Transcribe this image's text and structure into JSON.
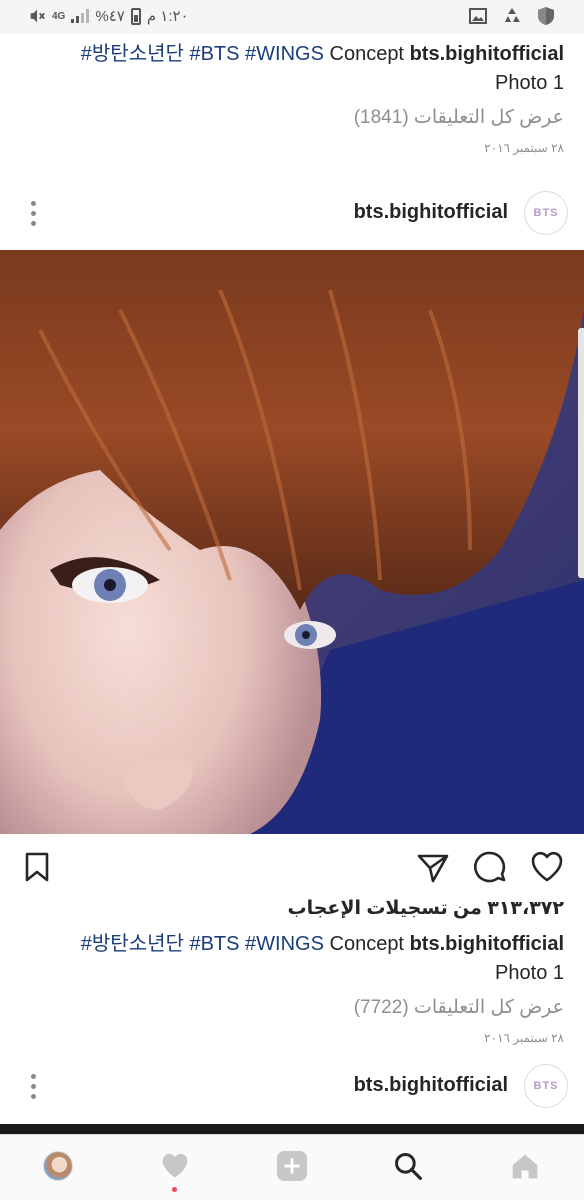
{
  "status_bar": {
    "time": "١:٢٠ م",
    "battery": "%٤٧",
    "network": "4G",
    "colors": {
      "background": "#f5f5f5",
      "icons": "#555555"
    }
  },
  "posts": [
    {
      "caption_tags": "#방탄소년단 #BTS #WINGS",
      "caption_text": "Concept",
      "caption_user": "bts.bighitofficial",
      "caption_line2": "Photo 1",
      "comments_link": "عرض كل التعليقات (1841)",
      "date": "٢٨ سبتمبر ٢٠١٦"
    },
    {
      "username": "bts.bighitofficial",
      "avatar_text": "BTS",
      "likes": "٣١٣،٣٧٢ من تسجيلات الإعجاب",
      "caption_tags": "#방탄소년단 #BTS #WINGS",
      "caption_text": "Concept",
      "caption_user": "bts.bighitofficial",
      "caption_line2": "Photo 1",
      "comments_link": "عرض كل التعليقات (7722)",
      "date": "٢٨ سبتمبر ٢٠١٦"
    },
    {
      "username": "bts.bighitofficial",
      "avatar_text": "BTS"
    }
  ],
  "bottom_nav": {
    "items": [
      "profile-avatar",
      "heart-icon",
      "add-icon",
      "search-icon",
      "home-icon"
    ],
    "active": "search-icon"
  },
  "colors": {
    "hashtag": "#1b3d7a",
    "muted": "#8e8e8e",
    "text": "#262626",
    "notification": "#ed4956"
  }
}
